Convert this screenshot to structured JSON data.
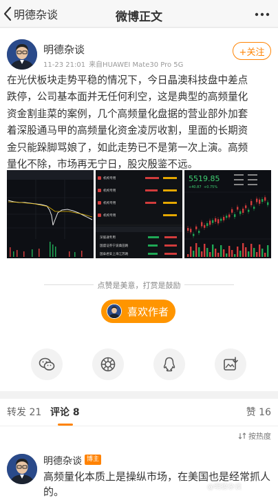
{
  "nav": {
    "back_label": "明德杂谈",
    "title": "微博正文"
  },
  "post": {
    "author": "明德杂谈",
    "time": "11-23 21:01",
    "source": "来自HUAWEI Mate30 Pro 5G",
    "follow_label": "+关注",
    "lines": [
      "在光伏板块走势平稳的情况下，今日晶澳科技盘中差点",
      "跌停，公司基本面并无任何利空，这是典型的高频量化",
      "资金割韭菜的案例，几个高频量化盘据的营业部外加套",
      "着深股通马甲的高频量化资金凌厉收割，里面的长期资",
      "金只能跺脚骂娘了，如此走势已不是第一次上演。高频",
      "量化不除，市场再无宁日，股灾殷鉴不远。"
    ]
  },
  "images": [
    {
      "icon": "intraday-chart-thumbnail"
    },
    {
      "icon": "broker-list-thumbnail",
      "rows_top": [
        "机构专用",
        "机构专用",
        "机构专用",
        "机构专用"
      ],
      "rows_bottom": [
        "深股通专用",
        "国盛证券宁波桑田路",
        "国泰君安上海江苏路"
      ]
    },
    {
      "icon": "kline-chart-thumbnail",
      "price": "5519.85",
      "change": "+40.87",
      "change_pct": "+0.75%"
    }
  ],
  "reward": {
    "hint": "点赞是美意，打赏是鼓励",
    "button_label": "喜欢作者"
  },
  "share": [
    {
      "icon": "wechat-icon"
    },
    {
      "icon": "moments-icon"
    },
    {
      "icon": "qq-icon"
    },
    {
      "icon": "save-image-icon"
    }
  ],
  "tabs": {
    "repost": "转发 21",
    "comments": "评论 8",
    "likes": "赞 16"
  },
  "sort_label": "按热度",
  "comment": {
    "author": "明德杂谈",
    "badge": "博主",
    "lines": [
      "高频量化本质上是操纵市场，在美国也是经常抓人",
      "的。"
    ]
  },
  "watermark": "@明德杂谈",
  "colors": {
    "accent": "#ff8200",
    "reward": "#ff9500"
  }
}
